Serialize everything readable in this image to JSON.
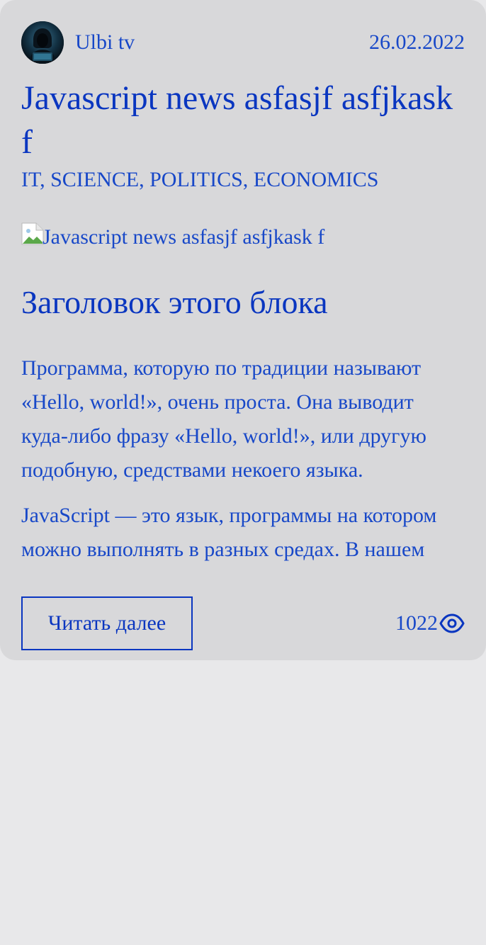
{
  "article": {
    "author": {
      "name": "Ulbi tv",
      "avatar_icon": "hacker-avatar-icon"
    },
    "date": "26.02.2022",
    "title": "Javascript news asfasjf asfjkask f",
    "tags": "IT, SCIENCE, POLITICS, ECONOMICS",
    "image": {
      "alt": "Javascript news asfasjf asfjkask f",
      "icon": "broken-image-icon"
    },
    "block": {
      "title": "Заголовок этого блока",
      "paragraphs": [
        "Программа, которую по традиции называют «Hello, world!», очень проста. Она выводит куда-либо фразу «Hello, world!», или другую подобную, средствами некоего языка.",
        "JavaScript — это язык, программы на котором можно выполнять в разных средах. В нашем"
      ]
    },
    "read_more_label": "Читать далее",
    "views": "1022",
    "views_icon": "eye-icon"
  },
  "colors": {
    "accent": "#0a36c0",
    "text": "#1848c8",
    "card_bg": "#d8d8da",
    "page_bg": "#e8e8ea"
  }
}
